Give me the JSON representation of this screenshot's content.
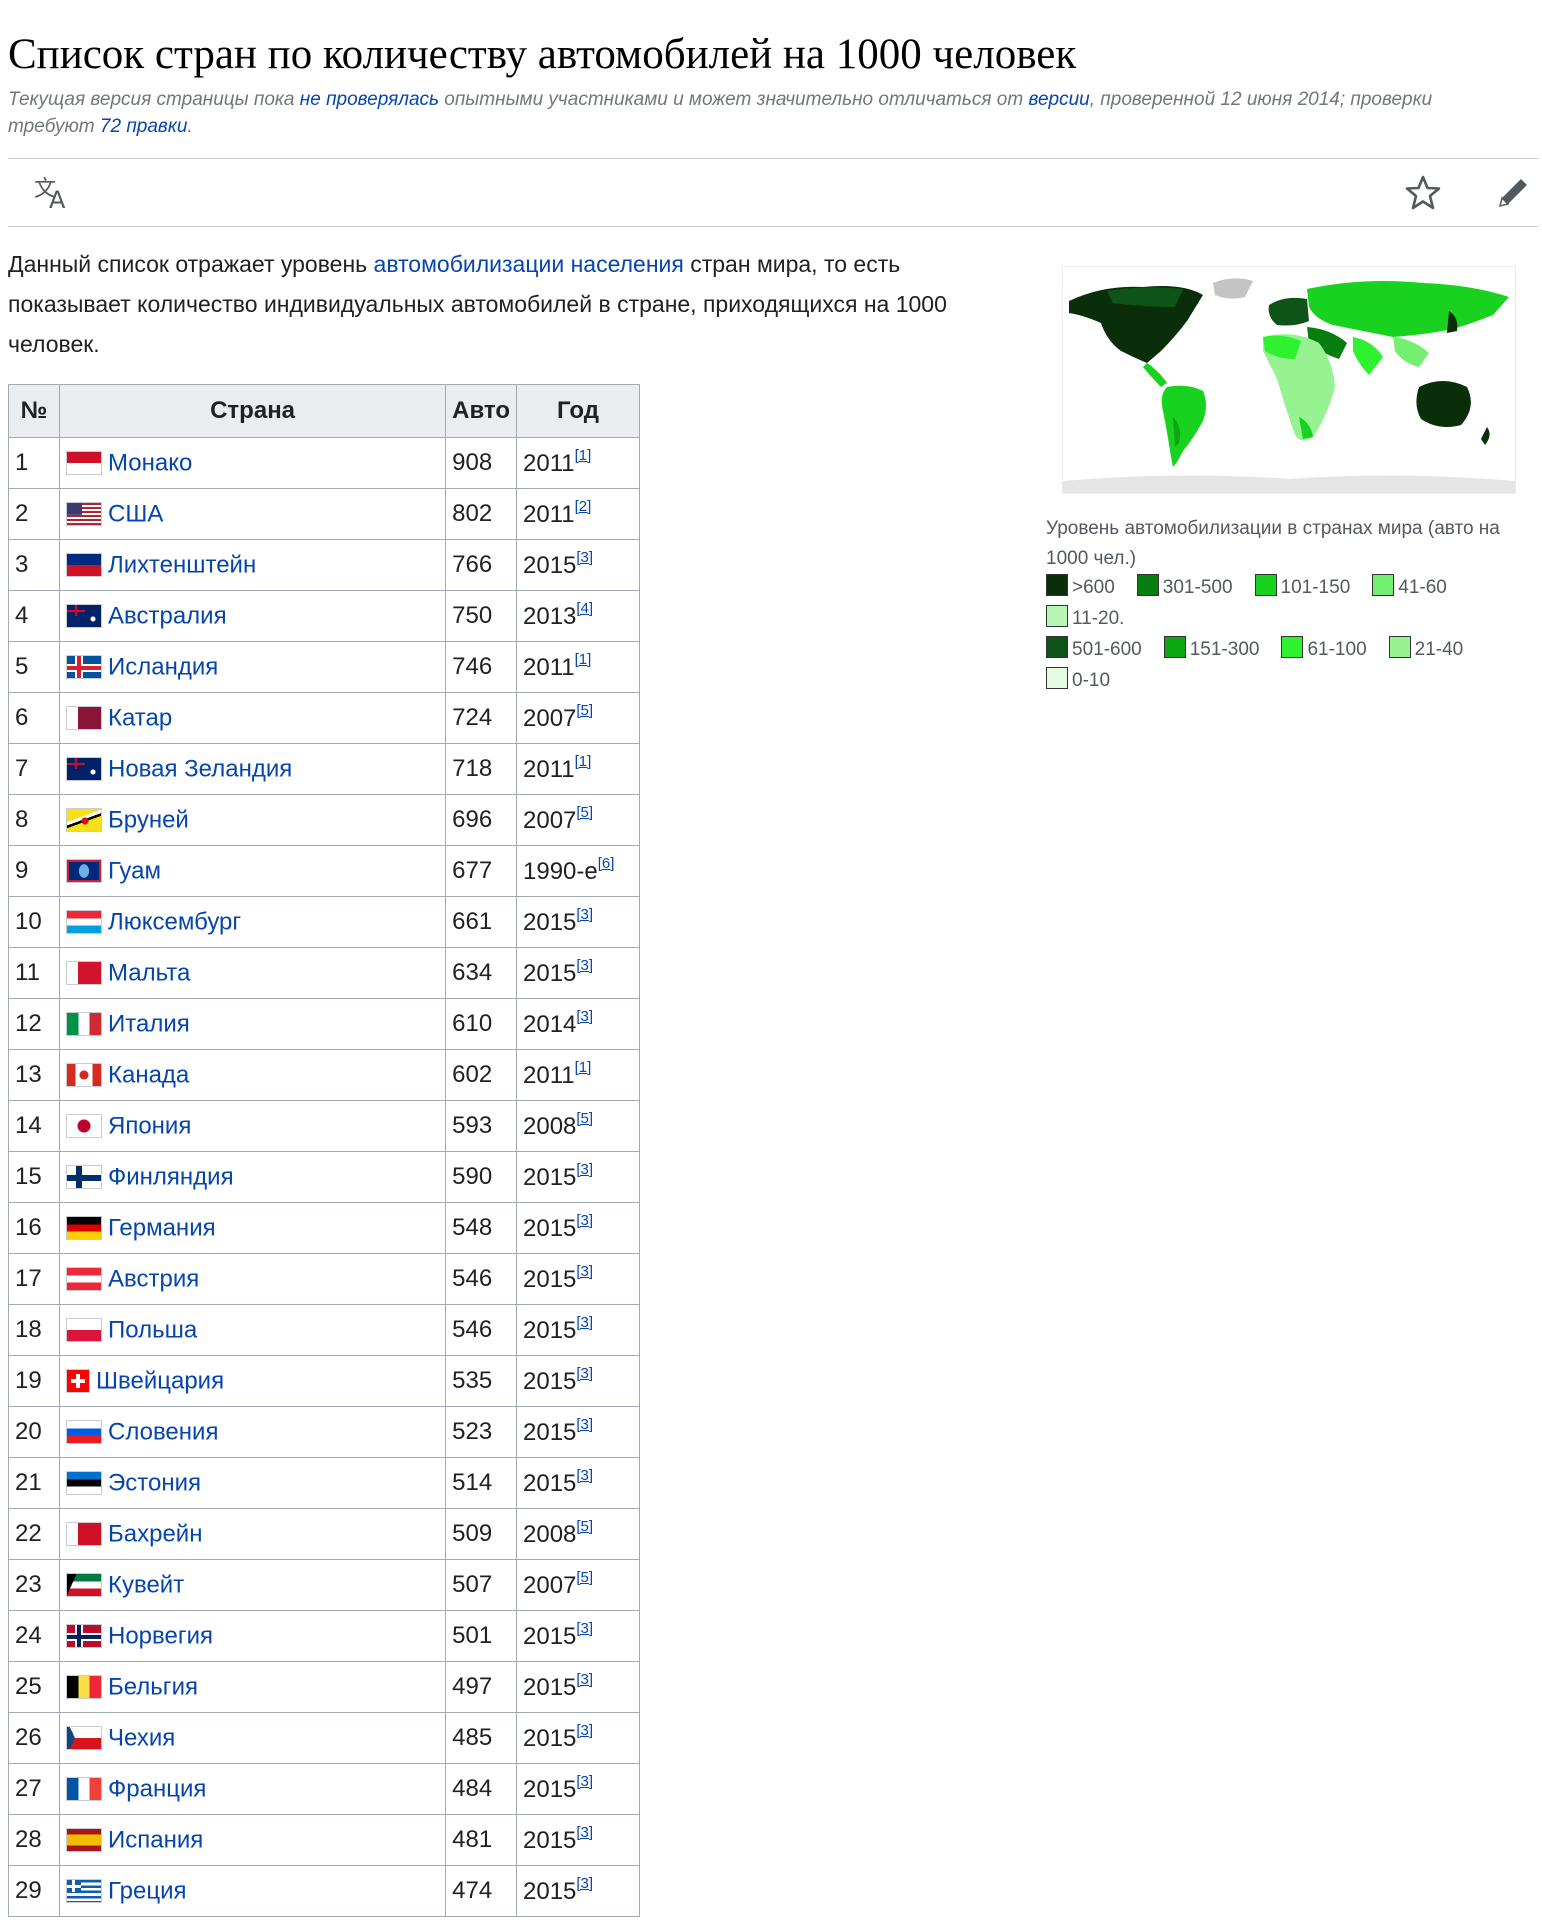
{
  "page": {
    "title": "Список стран по количеству автомобилей на 1000 человек",
    "notice": {
      "t1": "Текущая версия страницы пока ",
      "link1": "не проверялась",
      "t2": " опытными участниками и может значительно отличаться от ",
      "link2": "версии",
      "t3": ", проверенной 12 июня 2014; проверки требуют ",
      "link3": "72 правки",
      "t4": "."
    }
  },
  "toolbar": {
    "language_icon": "translate-icon",
    "watch_icon": "star-icon",
    "edit_icon": "pencil-icon"
  },
  "intro": {
    "t1": "Данный список отражает уровень ",
    "link": "автомобилизации населения",
    "t2": " стран мира, то есть показывает количество индивидуальных автомобилей в стране, приходящихся на 1000 человек."
  },
  "table": {
    "headers": [
      "№",
      "Страна",
      "Авто",
      "Год"
    ],
    "rows": [
      {
        "n": "1",
        "country": "Монако",
        "cars": "908",
        "year": "2011",
        "ref": "[1]",
        "flag": [
          "#ce1126",
          "#ffffff"
        ],
        "ft": "h"
      },
      {
        "n": "2",
        "country": "США",
        "cars": "802",
        "year": "2011",
        "ref": "[2]",
        "flag": [
          "#b22234",
          "#ffffff",
          "#3c3b6e"
        ],
        "ft": "us"
      },
      {
        "n": "3",
        "country": "Лихтенштейн",
        "cars": "766",
        "year": "2015",
        "ref": "[3]",
        "flag": [
          "#002b7f",
          "#ce1126"
        ],
        "ft": "h"
      },
      {
        "n": "4",
        "country": "Австралия",
        "cars": "750",
        "year": "2013",
        "ref": "[4]",
        "flag": [
          "#012169",
          "#ffffff",
          "#e4002b"
        ],
        "ft": "blue"
      },
      {
        "n": "5",
        "country": "Исландия",
        "cars": "746",
        "year": "2011",
        "ref": "[1]",
        "flag": [
          "#02529c",
          "#ffffff",
          "#dc1e35"
        ],
        "ft": "nordic"
      },
      {
        "n": "6",
        "country": "Катар",
        "cars": "724",
        "year": "2007",
        "ref": "[5]",
        "flag": [
          "#ffffff",
          "#8a1538"
        ],
        "ft": "v2"
      },
      {
        "n": "7",
        "country": "Новая Зеландия",
        "cars": "718",
        "year": "2011",
        "ref": "[1]",
        "flag": [
          "#012169",
          "#ffffff",
          "#c8102e"
        ],
        "ft": "blue"
      },
      {
        "n": "8",
        "country": "Бруней",
        "cars": "696",
        "year": "2007",
        "ref": "[5]",
        "flag": [
          "#f7e017",
          "#ffffff",
          "#000000"
        ],
        "ft": "diag"
      },
      {
        "n": "9",
        "country": "Гуам",
        "cars": "677",
        "year": "1990-е",
        "ref": "[6]",
        "flag": [
          "#00297b",
          "#c62139"
        ],
        "ft": "guam"
      },
      {
        "n": "10",
        "country": "Люксембург",
        "cars": "661",
        "year": "2015",
        "ref": "[3]",
        "flag": [
          "#ed2939",
          "#ffffff",
          "#00a1de"
        ],
        "ft": "h"
      },
      {
        "n": "11",
        "country": "Мальта",
        "cars": "634",
        "year": "2015",
        "ref": "[3]",
        "flag": [
          "#ffffff",
          "#cf142b"
        ],
        "ft": "v2"
      },
      {
        "n": "12",
        "country": "Италия",
        "cars": "610",
        "year": "2014",
        "ref": "[3]",
        "flag": [
          "#009246",
          "#ffffff",
          "#ce2b37"
        ],
        "ft": "v"
      },
      {
        "n": "13",
        "country": "Канада",
        "cars": "602",
        "year": "2011",
        "ref": "[1]",
        "flag": [
          "#d52b1e",
          "#ffffff",
          "#d52b1e"
        ],
        "ft": "canada"
      },
      {
        "n": "14",
        "country": "Япония",
        "cars": "593",
        "year": "2008",
        "ref": "[5]",
        "flag": [
          "#ffffff",
          "#bc002d"
        ],
        "ft": "japan"
      },
      {
        "n": "15",
        "country": "Финляндия",
        "cars": "590",
        "year": "2015",
        "ref": "[3]",
        "flag": [
          "#ffffff",
          "#002f6c"
        ],
        "ft": "nordic2"
      },
      {
        "n": "16",
        "country": "Германия",
        "cars": "548",
        "year": "2015",
        "ref": "[3]",
        "flag": [
          "#000000",
          "#dd0000",
          "#ffce00"
        ],
        "ft": "h"
      },
      {
        "n": "17",
        "country": "Австрия",
        "cars": "546",
        "year": "2015",
        "ref": "[3]",
        "flag": [
          "#ed2939",
          "#ffffff",
          "#ed2939"
        ],
        "ft": "h"
      },
      {
        "n": "18",
        "country": "Польша",
        "cars": "546",
        "year": "2015",
        "ref": "[3]",
        "flag": [
          "#ffffff",
          "#dc143c"
        ],
        "ft": "h"
      },
      {
        "n": "19",
        "country": "Швейцария",
        "cars": "535",
        "year": "2015",
        "ref": "[3]",
        "flag": [
          "#ff0000",
          "#ffffff"
        ],
        "ft": "swiss"
      },
      {
        "n": "20",
        "country": "Словения",
        "cars": "523",
        "year": "2015",
        "ref": "[3]",
        "flag": [
          "#ffffff",
          "#005ce5",
          "#ed1c24"
        ],
        "ft": "h"
      },
      {
        "n": "21",
        "country": "Эстония",
        "cars": "514",
        "year": "2015",
        "ref": "[3]",
        "flag": [
          "#0072ce",
          "#000000",
          "#ffffff"
        ],
        "ft": "h"
      },
      {
        "n": "22",
        "country": "Бахрейн",
        "cars": "509",
        "year": "2008",
        "ref": "[5]",
        "flag": [
          "#ffffff",
          "#ce1126"
        ],
        "ft": "v2"
      },
      {
        "n": "23",
        "country": "Кувейт",
        "cars": "507",
        "year": "2007",
        "ref": "[5]",
        "flag": [
          "#007a3d",
          "#ffffff",
          "#ce1126"
        ],
        "ft": "kuwait"
      },
      {
        "n": "24",
        "country": "Норвегия",
        "cars": "501",
        "year": "2015",
        "ref": "[3]",
        "flag": [
          "#ba0c2f",
          "#ffffff",
          "#00205b"
        ],
        "ft": "nordic"
      },
      {
        "n": "25",
        "country": "Бельгия",
        "cars": "497",
        "year": "2015",
        "ref": "[3]",
        "flag": [
          "#000000",
          "#fae042",
          "#ed2939"
        ],
        "ft": "v"
      },
      {
        "n": "26",
        "country": "Чехия",
        "cars": "485",
        "year": "2015",
        "ref": "[3]",
        "flag": [
          "#ffffff",
          "#d7141a",
          "#11457e"
        ],
        "ft": "czech"
      },
      {
        "n": "27",
        "country": "Франция",
        "cars": "484",
        "year": "2015",
        "ref": "[3]",
        "flag": [
          "#0055a4",
          "#ffffff",
          "#ef4135"
        ],
        "ft": "v"
      },
      {
        "n": "28",
        "country": "Испания",
        "cars": "481",
        "year": "2015",
        "ref": "[3]",
        "flag": [
          "#aa151b",
          "#f1bf00",
          "#aa151b"
        ],
        "ft": "spain"
      },
      {
        "n": "29",
        "country": "Греция",
        "cars": "474",
        "year": "2015",
        "ref": "[3]",
        "flag": [
          "#0d5eaf",
          "#ffffff"
        ],
        "ft": "greece"
      }
    ]
  },
  "map": {
    "caption": "Уровень автомобилизации в странах мира (авто на 1000 чел.)",
    "legend_rows": [
      [
        {
          "label": ">600",
          "color": "#0a2e0a"
        },
        {
          "label": "301-500",
          "color": "#067d0f"
        },
        {
          "label": "101-150",
          "color": "#19d21f"
        },
        {
          "label": "41-60",
          "color": "#73f072"
        }
      ],
      [
        {
          "label": "11-20.",
          "color": "#b6f5b2"
        }
      ],
      [
        {
          "label": "501-600",
          "color": "#0e5418"
        },
        {
          "label": "151-300",
          "color": "#0ca814"
        },
        {
          "label": "61-100",
          "color": "#2ff22f"
        },
        {
          "label": "21-40",
          "color": "#97f292"
        }
      ],
      [
        {
          "label": "0-10",
          "color": "#e6fbe4"
        }
      ]
    ]
  }
}
